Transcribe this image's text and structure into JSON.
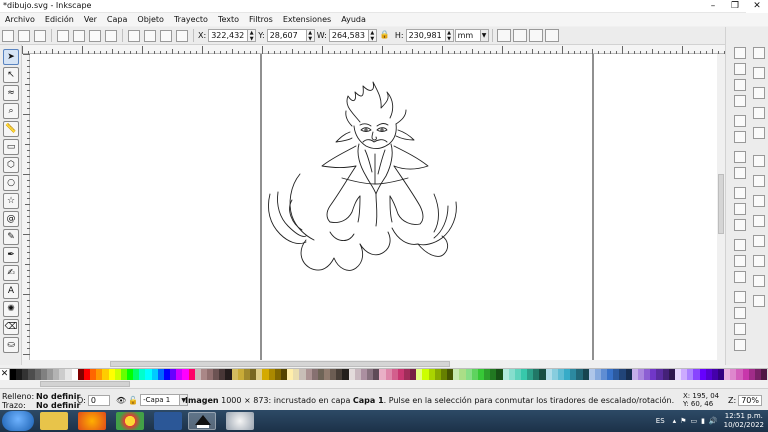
{
  "window": {
    "title": "*dibujo.svg - Inkscape"
  },
  "menu": [
    "Archivo",
    "Edición",
    "Ver",
    "Capa",
    "Objeto",
    "Trayecto",
    "Texto",
    "Filtros",
    "Extensiones",
    "Ayuda"
  ],
  "toolbar": {
    "x_label": "X:",
    "x_value": "322,432",
    "y_label": "Y:",
    "y_value": "28,607",
    "w_label": "W:",
    "w_value": "264,583",
    "h_label": "H:",
    "h_value": "230,981",
    "unit": "mm"
  },
  "status": {
    "fill_label": "Relleno:",
    "fill_value": "No definir",
    "stroke_label": "Trazo:",
    "stroke_value": "No definir",
    "opacity_label": "O:",
    "opacity_value": "0",
    "layer_value": "-Capa 1",
    "msg_strong": "Imagen",
    "msg_mid": " 1000 × 873: incrustado en capa ",
    "msg_layer": "Capa 1",
    "msg_tail": ". Pulse en la selección para conmutar los tiradores de escalado/rotación.",
    "x_coord": "X:  195, 04",
    "y_coord": "Y:    60, 46",
    "zoom_label": "Z:",
    "zoom_value": "70%"
  },
  "taskbar": {
    "lang": "ES",
    "time": "12:51 p.m.",
    "date": "10/02/2022"
  },
  "colors": {
    "palette": [
      "#000000",
      "#1a1a1a",
      "#333333",
      "#4d4d4d",
      "#666666",
      "#808080",
      "#999999",
      "#b3b3b3",
      "#cccccc",
      "#e6e6e6",
      "#ffffff",
      "#800000",
      "#ff0000",
      "#ff6600",
      "#ff9900",
      "#ffcc00",
      "#ffff00",
      "#ccff00",
      "#66ff00",
      "#00ff00",
      "#00ff66",
      "#00ffcc",
      "#00ffff",
      "#00ccff",
      "#0066ff",
      "#0000ff",
      "#6600ff",
      "#cc00ff",
      "#ff00ff",
      "#ff0066",
      "#c8b7b7",
      "#aa8787",
      "#916f6f",
      "#6c5353",
      "#483737",
      "#241c1c",
      "#d3bc5f",
      "#c8ab37",
      "#a0892c",
      "#786721",
      "#decd87",
      "#d4aa00",
      "#aa8800",
      "#806600",
      "#554400",
      "#ffeeaa",
      "#e9ddaf",
      "#c8beb7",
      "#ac9393",
      "#877171",
      "#6f6457",
      "#917c6f",
      "#6c5d53",
      "#483e37",
      "#241f1c",
      "#e3dbdb",
      "#c8b7be",
      "#ab8fa0",
      "#87717e",
      "#5f4b57",
      "#e9afc6",
      "#de87aa",
      "#d35f8d",
      "#c83771",
      "#a02c59",
      "#782143",
      "#e5ff80",
      "#ccff00",
      "#aad400",
      "#88aa00",
      "#668000",
      "#445500",
      "#c6e9af",
      "#aade87",
      "#87de87",
      "#5fd35f",
      "#37c837",
      "#2ca02c",
      "#217821",
      "#165016",
      "#afe9dd",
      "#87decd",
      "#5fd3bc",
      "#37c8ab",
      "#2ca089",
      "#217867",
      "#164f44",
      "#afdde9",
      "#87cdde",
      "#5fbcd3",
      "#37abc8",
      "#2c89a0",
      "#216778",
      "#164450",
      "#afc6e9",
      "#87aade",
      "#5f8dd3",
      "#3771c8",
      "#2c5aa0",
      "#214478",
      "#162d50",
      "#c6afe9",
      "#aa87de",
      "#8d5fd3",
      "#7137c8",
      "#5a2ca0",
      "#442178",
      "#2d1650",
      "#e5d5ff",
      "#ccaaff",
      "#aa80ff",
      "#8844ff",
      "#6600ff",
      "#5500d4",
      "#4400aa",
      "#330080",
      "#e9afdd",
      "#de87cd",
      "#d35fbc",
      "#c837ab",
      "#a02c89",
      "#782167",
      "#501644"
    ]
  }
}
